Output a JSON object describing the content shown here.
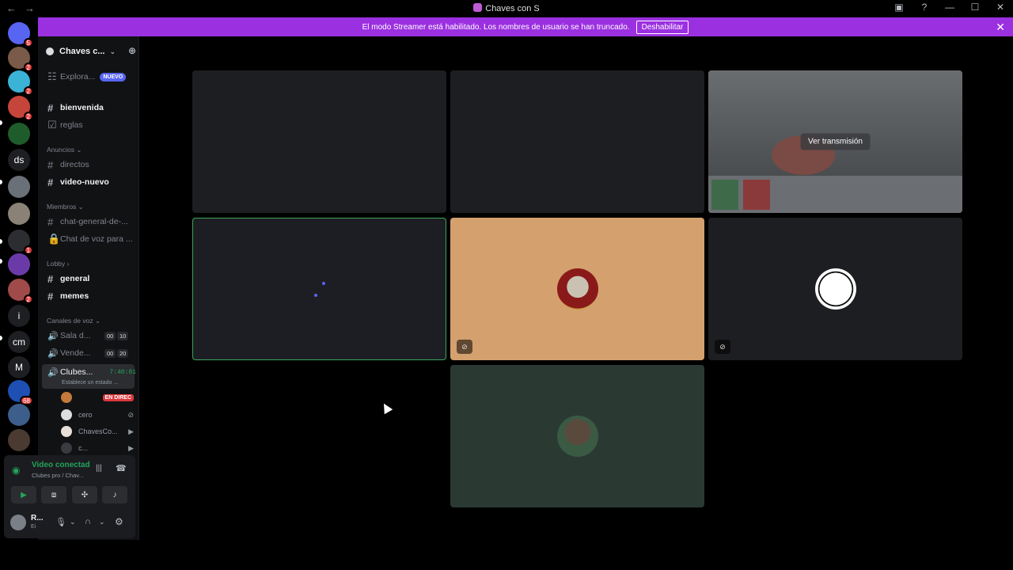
{
  "window": {
    "title": "Chaves con S",
    "nav_back": "←",
    "nav_forward": "→",
    "controls": [
      "—",
      "☐",
      "✕"
    ]
  },
  "banner": {
    "message": "El modo Streamer está habilitado. Los nombres de usuario se han truncado.",
    "button": "Deshabilitar",
    "close": "✕"
  },
  "rail": {
    "servers": [
      {
        "label": "",
        "badge": "5",
        "color": "#5865f2"
      },
      {
        "label": "",
        "badge": "2",
        "color": "#7a5a48"
      },
      {
        "label": "",
        "badge": "2",
        "color": "#3bb3d6"
      },
      {
        "label": "",
        "badge": "2",
        "color": "#c6453b"
      },
      {
        "label": "",
        "badge": "",
        "color": "#1f5c2b"
      },
      {
        "label": "ds",
        "badge": "",
        "color": "#1e1f22"
      },
      {
        "label": "",
        "badge": "",
        "color": "#6a7077"
      },
      {
        "label": "",
        "badge": "",
        "color": "#8a8276"
      },
      {
        "label": "",
        "badge": "1",
        "color": "#2b2d31"
      },
      {
        "label": "",
        "badge": "",
        "color": "#6a3ba8"
      },
      {
        "label": "",
        "badge": "2",
        "color": "#a04a4a"
      },
      {
        "label": "i",
        "badge": "",
        "color": "#1e1f22"
      },
      {
        "label": "cm",
        "badge": "",
        "color": "#1e1f22"
      },
      {
        "label": "M",
        "badge": "",
        "color": "#1e1f22"
      },
      {
        "label": "",
        "badge": "68",
        "color": "#1e4fb3"
      },
      {
        "label": "",
        "badge": "",
        "color": "#3d5d8a"
      },
      {
        "label": "",
        "badge": "",
        "color": "#4b3a30"
      }
    ]
  },
  "sidebar": {
    "guild_name": "Chaves c...",
    "explore": "Explora...",
    "explore_badge": "NUEVO",
    "channels_top": [
      {
        "name": "bienvenida",
        "unread": true
      },
      {
        "name": "reglas",
        "unread": false
      }
    ],
    "cat_anuncios": "Anuncios",
    "anuncios": [
      {
        "name": "directos",
        "unread": false
      },
      {
        "name": "video-nuevo",
        "unread": true
      }
    ],
    "cat_miembros": "Miembros",
    "miembros": [
      {
        "name": "chat-general-de-...",
        "unread": false
      },
      {
        "name": "Chat de voz para ...",
        "unread": false
      }
    ],
    "cat_lobby": "Lobby",
    "lobby": [
      {
        "name": "general",
        "unread": true
      },
      {
        "name": "memes",
        "unread": true
      }
    ],
    "cat_voz": "Canales de voz",
    "voice": [
      {
        "name": "Sala d...",
        "a": "00",
        "b": "10"
      },
      {
        "name": "Vende...",
        "a": "00",
        "b": "20"
      }
    ],
    "active_channel": {
      "name": "Clubes...",
      "timer": "7:40:01",
      "status": "Establece un estado ..."
    },
    "voice_users": [
      {
        "name": "",
        "live": "EN DIREC",
        "color": "#c47a3a"
      },
      {
        "name": "cero",
        "live": "",
        "color": "#dddddd"
      },
      {
        "name": "ChavesCo...",
        "live": "",
        "color": "#e8e0d8"
      },
      {
        "name": "c...",
        "live": "",
        "color": "#3a3b40"
      }
    ]
  },
  "voice_panel": {
    "status": "Video conectad",
    "channel": "Clubes pro / Chav...",
    "user_name": "R...",
    "user_status": "Ei"
  },
  "stage": {
    "tiles": [
      {
        "kind": "blank"
      },
      {
        "kind": "blank"
      },
      {
        "kind": "stream",
        "button": "Ver transmisión"
      },
      {
        "kind": "loading"
      },
      {
        "kind": "avatar",
        "bg": "#d4a06e"
      },
      {
        "kind": "avatar",
        "bg": "#1d1e21"
      },
      {
        "kind": "avatar",
        "bg": "#2a3a33"
      }
    ]
  }
}
